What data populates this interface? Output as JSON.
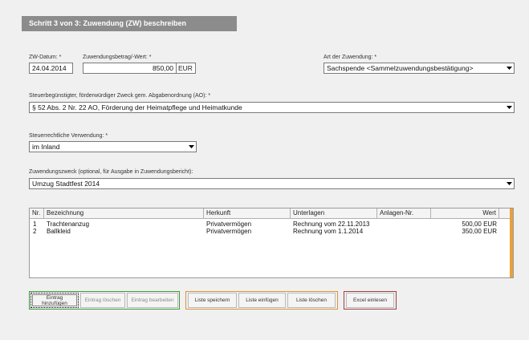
{
  "header": {
    "title": "Schritt 3 von 3:  Zuwendung (ZW) beschreiben"
  },
  "zw_datum": {
    "label": "ZW-Datum: *",
    "value": "24.04.2014"
  },
  "betrag": {
    "label": "Zuwendungsbetrag/-Wert: *",
    "value": "850,00",
    "unit": "EUR"
  },
  "art": {
    "label": "Art der Zuwendung: *",
    "value": "Sachspende  <Sammelzuwendungsbestätigung>"
  },
  "beguenstigter": {
    "label": "Steuerbegünstigter, förderwürdiger Zweck gem. Abgabenordnung (AO): *",
    "value": "§ 52 Abs. 2 Nr. 22 AO, Förderung der Heimatpflege und Heimatkunde"
  },
  "verwendung": {
    "label": "Steuerrechtliche Verwendung: *",
    "value": "im Inland"
  },
  "zweck": {
    "label": "Zuwendungszweck (optional, für Ausgabe in Zuwendungsbericht):",
    "value": "Umzug Stadtfest 2014"
  },
  "table": {
    "columns": [
      "Nr.",
      "Bezeichnung",
      "Herkunft",
      "Unterlagen",
      "Anlagen-Nr.",
      "Wert"
    ],
    "rows": [
      {
        "nr": "1",
        "bezeichnung": "Trachtenanzug",
        "herkunft": "Privatvermögen",
        "unterlagen": "Rechnung vom 22.11.2013",
        "anlagen": "",
        "wert": "500,00 EUR"
      },
      {
        "nr": "2",
        "bezeichnung": "Ballkleid",
        "herkunft": "Privatvermögen",
        "unterlagen": "Rechnung vom 1.1.2014",
        "anlagen": "",
        "wert": "350,00 EUR"
      }
    ]
  },
  "buttons": {
    "add_line1": "Eintrag",
    "add_line2": "hinzufügen",
    "delete": "Eintrag löschen",
    "edit": "Eintrag bearbeiten",
    "save_list": "Liste speichern",
    "insert_list": "Liste einfügen",
    "delete_list": "Liste löschen",
    "excel": "Excel einlesen"
  },
  "colors": {
    "header_bg": "#8c8c8c",
    "group_green": "#3c9a3c",
    "group_orange": "#d9953a",
    "group_red": "#a04040",
    "table_accent": "#e8a13a"
  }
}
